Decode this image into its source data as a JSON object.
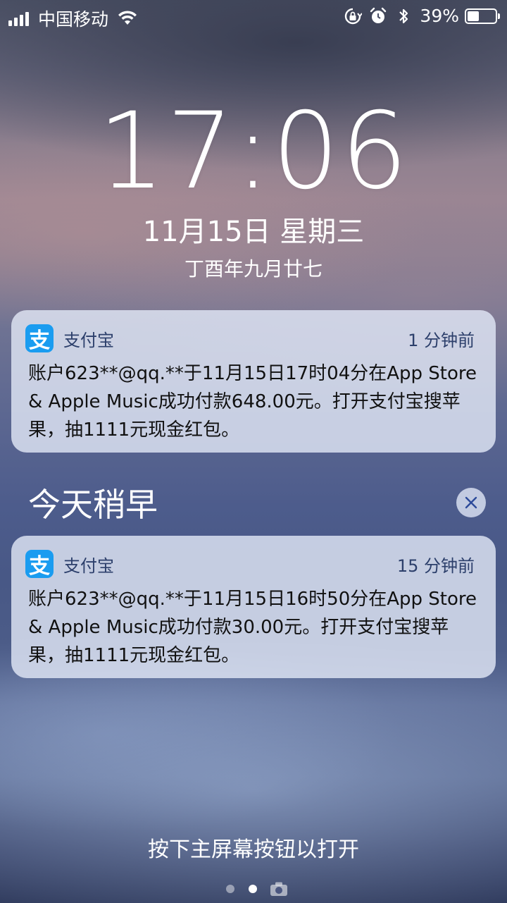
{
  "status_bar": {
    "carrier": "中国移动",
    "battery_percent": "39%",
    "battery_level": 0.39,
    "icons": [
      "signal-icon",
      "wifi-icon",
      "rotation-lock-icon",
      "alarm-icon",
      "bluetooth-icon",
      "battery-icon"
    ]
  },
  "lock_screen": {
    "time": "17:06",
    "date": "11月15日 星期三",
    "lunar_date": "丁酉年九月廿七",
    "section_title": "今天稍早",
    "unlock_hint": "按下主屏幕按钮以打开"
  },
  "notifications": [
    {
      "app_name": "支付宝",
      "app_icon_glyph": "支",
      "time": "1 分钟前",
      "body": "账户623**@qq.**于11月15日17时04分在App Store & Apple Music成功付款648.00元。打开支付宝搜苹果，抽1111元现金红包。"
    },
    {
      "app_name": "支付宝",
      "app_icon_glyph": "支",
      "time": "15 分钟前",
      "body": "账户623**@qq.**于11月15日16时50分在App Store & Apple Music成功付款30.00元。打开支付宝搜苹果，抽1111元现金红包。"
    }
  ],
  "colors": {
    "alipay_blue": "#1a9cf0",
    "notification_bg": "#e1e6f5",
    "header_text": "#2c3f6b"
  }
}
